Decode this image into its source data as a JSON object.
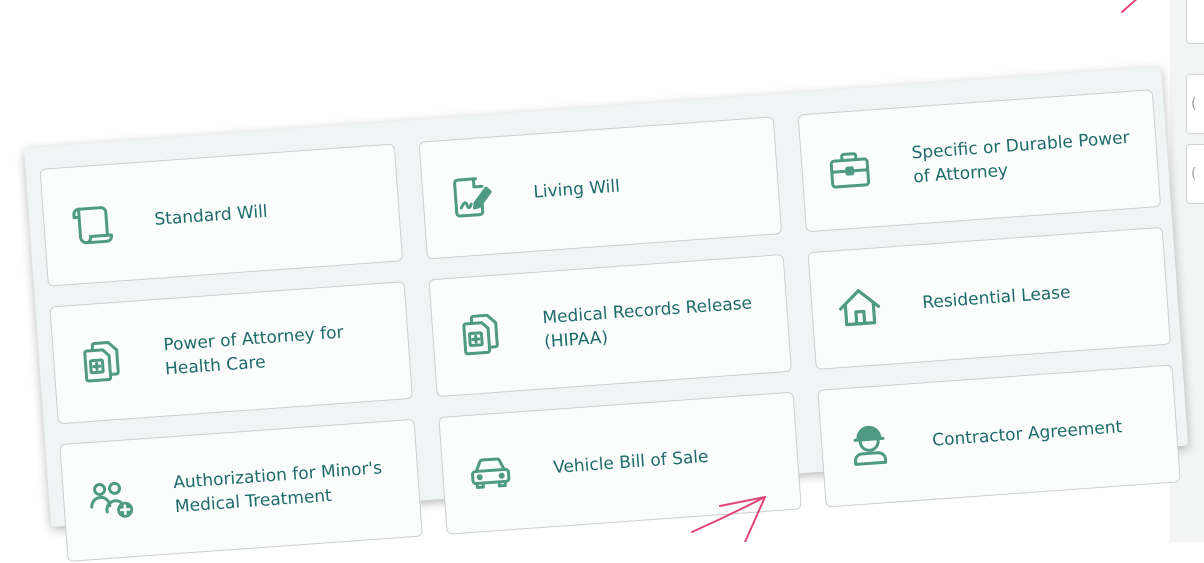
{
  "colors": {
    "icon": "#4e9a83",
    "label": "#1d6b6a",
    "accent_stroke": "#e0457b",
    "panel_bg": "#f1f4f4",
    "card_bg": "#fbfcfc"
  },
  "documents": [
    {
      "label": "Standard Will",
      "icon": "scroll-icon"
    },
    {
      "label": "Living Will",
      "icon": "signed-document-icon"
    },
    {
      "label": "Specific or Durable Power of Attorney",
      "icon": "briefcase-icon"
    },
    {
      "label": "Power of Attorney for Health Care",
      "icon": "medical-documents-icon"
    },
    {
      "label": "Medical Records Release (HIPAA)",
      "icon": "medical-documents-icon"
    },
    {
      "label": "Residential Lease",
      "icon": "house-icon"
    },
    {
      "label": "Authorization for Minor's Medical Treatment",
      "icon": "add-people-icon"
    },
    {
      "label": "Vehicle Bill of Sale",
      "icon": "car-icon"
    },
    {
      "label": "Contractor Agreement",
      "icon": "hard-hat-worker-icon"
    }
  ]
}
